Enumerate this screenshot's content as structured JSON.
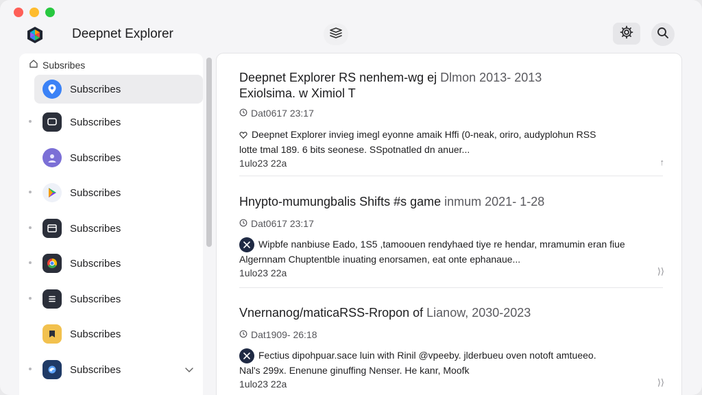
{
  "window": {
    "app_title": "Deepnet Explorer"
  },
  "sidebar": {
    "header_label": "Subsribes",
    "items": [
      {
        "label": "Subscribes",
        "icon": "location-pin-icon",
        "color": "#3b82f6",
        "active": true
      },
      {
        "label": "Subscribes",
        "icon": "chat-bubble-icon",
        "color": "#2b2f3a"
      },
      {
        "label": "Subscribes",
        "icon": "user-avatar-icon",
        "color": "#7b6fd6"
      },
      {
        "label": "Subscribes",
        "icon": "play-store-icon",
        "color": "#e9eef8"
      },
      {
        "label": "Subscribes",
        "icon": "browser-window-icon",
        "color": "#2b2f3a"
      },
      {
        "label": "Subscribes",
        "icon": "chrome-circle-icon",
        "color": "#2b2f3a"
      },
      {
        "label": "Subscribes",
        "icon": "stack-list-icon",
        "color": "#2b2f3a"
      },
      {
        "label": "Subscribes",
        "icon": "bookmark-icon",
        "color": "#f2c14e"
      },
      {
        "label": "Subscribes",
        "icon": "swirl-icon",
        "color": "#1f3a66"
      }
    ]
  },
  "articles": [
    {
      "title_main": "Deepnet Explorer RS nenhem-wg ej",
      "title_muted": " Dlmon 2013- 2013",
      "title_line2": "Exiolsima. w Ximiol T",
      "date": "Dat0617 23:17",
      "body_line1": "Deepnet Explorer invieg imegl eyonne amaik Hffi (0-neak, oriro, audyplohun RSS",
      "body_line2": "lotte tmal 189. 6 bits seonese. SSpotnatled dn anuer...",
      "footer": "1ulo23 22a",
      "action": "↑"
    },
    {
      "title_main": "Hnypto-mumungbalis Shifts #s game",
      "title_muted": " inmum 2021- 1-28",
      "date": "Dat0617 23:17",
      "body_line1": "Wipbfe nanbiuse Eado, 1S5 ,tamoouen rendyhaed tiye re hendar, mramumin eran fiue",
      "body_line2": "Algernnam Chuptentble inuating enorsamen, eat onte ephanaue...",
      "footer": "1ulo23 22a",
      "action": "⟩⟩"
    },
    {
      "title_main": "Vnernanog/maticaRSS-Rropon of",
      "title_muted": " Lianow, 2030-2023",
      "date": "Dat1909- 26:18",
      "body_line1": "Fectius dipohpuar.sace luin with Rinil @vpeeby. jlderbueu oven notoft amtueeo.",
      "body_line2": "Nal's 299x. Enenune ginuffing Nenser. He kanr, Moofk",
      "footer": "1ulo23 22a",
      "action": "⟩⟩"
    }
  ],
  "colors": {
    "accent": "#3b82f6",
    "traffic_red": "#fe5f57",
    "traffic_yellow": "#febc2e",
    "traffic_green": "#28c840"
  }
}
